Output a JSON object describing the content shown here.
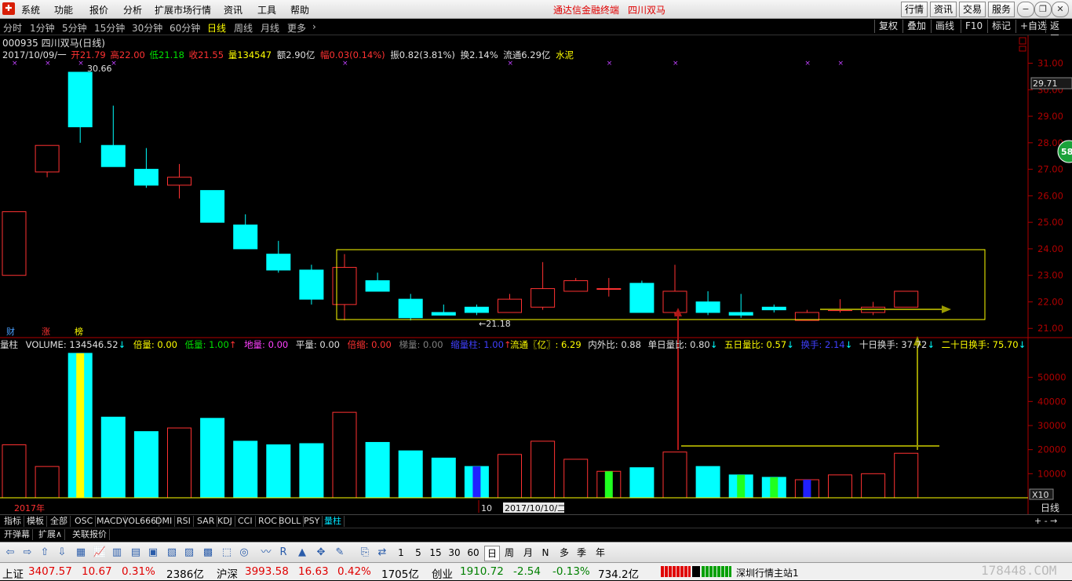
{
  "menu": [
    "系统",
    "功能",
    "报价",
    "分析",
    "扩展市场行情",
    "资讯",
    "工具",
    "帮助"
  ],
  "app_title": "通达信金融终端",
  "app_stock": "四川双马",
  "top_buttons": [
    "行情",
    "资讯",
    "交易",
    "服务"
  ],
  "periods": [
    "分时",
    "1分钟",
    "5分钟",
    "15分钟",
    "30分钟",
    "60分钟",
    "日线",
    "周线",
    "月线",
    "更多"
  ],
  "active_period": "日线",
  "right_buttons": [
    "复权",
    "叠加",
    "画线",
    "F10",
    "标记",
    "+自选",
    "返回"
  ],
  "stock_header": "000935 四川双马(日线)",
  "quote": {
    "date": "2017/10/09/一",
    "open_label": "开",
    "open": "21.79",
    "high_label": "高",
    "high": "22.00",
    "low_label": "低",
    "low": "21.18",
    "close_label": "收",
    "close": "21.55",
    "vol_label": "量",
    "vol": "134547",
    "amount": "额2.90亿",
    "change": "幅0.03(0.14%)",
    "amplitude": "振0.82(3.81%)",
    "turnover": "换2.14%",
    "float_cap": "流通6.29亿",
    "industry": "水泥"
  },
  "price_axis": [
    "31.00",
    "30.00",
    "29.00",
    "28.00",
    "27.00",
    "26.00",
    "25.00",
    "24.00",
    "23.00",
    "22.00",
    "21.00"
  ],
  "price_cursor": "29.71",
  "high_marker": "30.66",
  "low_marker": "←21.18",
  "circle_badge": "58",
  "markers": [
    "财",
    "涨",
    "榜"
  ],
  "vol_indicator": {
    "name": "量柱",
    "volume": "VOLUME: 134546.52",
    "beiliang": "倍量: 0.00",
    "diliang": "低量: 1.00",
    "diliang2": "地量: 0.00",
    "pingliang": "平量: 0.00",
    "beisuo": "倍缩: 0.00",
    "tiliang": "梯量: 0.00",
    "suoliang": "缩量柱: 1.00",
    "liutong": "流通〖亿〗: 6.29",
    "neiwai": "内外比: 0.88",
    "danri": "单日量比: 0.80",
    "wuri": "五日量比: 0.57",
    "huanshou": "换手: 2.14",
    "shiri": "十日换手: 37.72",
    "ershiri": "二十日换手: 75.70"
  },
  "vol_axis": [
    "50000",
    "40000",
    "30000",
    "20000",
    "10000"
  ],
  "vol_unit": "X10",
  "time_labels": {
    "year": "2017年",
    "month": "10",
    "cursor": "2017/10/10/二"
  },
  "chart_data": {
    "type": "candlestick",
    "ylim": [
      20.8,
      31.4
    ],
    "candles": [
      {
        "o": 23.0,
        "h": 25.4,
        "l": 23.0,
        "c": 25.4
      },
      {
        "o": 26.9,
        "h": 27.9,
        "l": 26.7,
        "c": 27.9
      },
      {
        "o": 30.66,
        "h": 30.66,
        "l": 28.0,
        "c": 28.6
      },
      {
        "o": 27.9,
        "h": 29.4,
        "l": 27.1,
        "c": 27.1
      },
      {
        "o": 27.0,
        "h": 27.8,
        "l": 26.3,
        "c": 26.4
      },
      {
        "o": 26.4,
        "h": 27.2,
        "l": 25.9,
        "c": 26.7
      },
      {
        "o": 26.2,
        "h": 26.2,
        "l": 25.0,
        "c": 25.0
      },
      {
        "o": 24.9,
        "h": 25.3,
        "l": 24.0,
        "c": 24.0
      },
      {
        "o": 23.8,
        "h": 24.3,
        "l": 23.1,
        "c": 23.2
      },
      {
        "o": 23.2,
        "h": 23.4,
        "l": 21.9,
        "c": 22.1
      },
      {
        "o": 21.9,
        "h": 23.8,
        "l": 21.3,
        "c": 23.3
      },
      {
        "o": 22.8,
        "h": 23.1,
        "l": 22.4,
        "c": 22.4
      },
      {
        "o": 22.1,
        "h": 22.3,
        "l": 21.3,
        "c": 21.4
      },
      {
        "o": 21.6,
        "h": 21.9,
        "l": 21.5,
        "c": 21.5
      },
      {
        "o": 21.8,
        "h": 21.9,
        "l": 21.5,
        "c": 21.6
      },
      {
        "o": 21.6,
        "h": 22.3,
        "l": 21.6,
        "c": 22.1
      },
      {
        "o": 21.8,
        "h": 23.5,
        "l": 21.7,
        "c": 22.5
      },
      {
        "o": 22.4,
        "h": 22.9,
        "l": 22.4,
        "c": 22.8
      },
      {
        "o": 22.5,
        "h": 22.9,
        "l": 22.2,
        "c": 22.5
      },
      {
        "o": 22.7,
        "h": 22.8,
        "l": 21.6,
        "c": 21.6
      },
      {
        "o": 21.6,
        "h": 23.4,
        "l": 21.5,
        "c": 22.4
      },
      {
        "o": 22.0,
        "h": 22.4,
        "l": 21.5,
        "c": 21.6
      },
      {
        "o": 21.6,
        "h": 22.3,
        "l": 21.4,
        "c": 21.5
      },
      {
        "o": 21.8,
        "h": 21.9,
        "l": 21.6,
        "c": 21.7
      },
      {
        "o": 21.3,
        "h": 21.7,
        "l": 21.3,
        "c": 21.6
      },
      {
        "o": 21.7,
        "h": 22.1,
        "l": 21.6,
        "c": 21.7
      },
      {
        "o": 21.6,
        "h": 22.0,
        "l": 21.5,
        "c": 21.8
      },
      {
        "o": 21.8,
        "h": 22.4,
        "l": 21.8,
        "c": 22.4
      }
    ],
    "volumes": [
      22000,
      13000,
      60000,
      33500,
      27500,
      29000,
      33000,
      23500,
      22000,
      22500,
      35500,
      23000,
      19500,
      16500,
      13000,
      18000,
      23500,
      16000,
      11000,
      12500,
      19000,
      13000,
      9500,
      8500,
      7500,
      9500,
      10000,
      18500
    ],
    "vol_ylim": [
      0,
      60000
    ],
    "markers_top": [
      0,
      1,
      2,
      3,
      10,
      15,
      18,
      20,
      24,
      25
    ]
  },
  "tabs": [
    "指标",
    "模板",
    "全部",
    "OSC",
    "MACD",
    "VOL666",
    "DMI",
    "RSI",
    "SAR",
    "KDJ",
    "CCI",
    "ROC",
    "BOLL",
    "PSY",
    "量柱"
  ],
  "active_tab": "量柱",
  "sub_tabs": [
    "开弹幕",
    "扩展∧",
    "关联报价"
  ],
  "right_period_label": "日线",
  "zoom_label": "+ - →",
  "toolbar_periods": [
    "1",
    "5",
    "15",
    "30",
    "60",
    "日",
    "周",
    "月",
    "N",
    "多",
    "季",
    "年"
  ],
  "status": {
    "sh_label": "上证",
    "sh_val": "3407.57",
    "sh_chg": "10.67",
    "sh_pct": "0.31%",
    "sh_amt": "2386亿",
    "sz_label": "沪深",
    "sz_val": "3993.58",
    "sz_chg": "16.63",
    "sz_pct": "0.42%",
    "sz_amt": "1705亿",
    "cy_label": "创业",
    "cy_val": "1910.72",
    "cy_chg": "-2.54",
    "cy_pct": "-0.13%",
    "cy_amt": "734.2亿",
    "server": "深圳行情主站1",
    "watermark": "178448.COM"
  },
  "colors": {
    "up": "#ff3232",
    "down": "#00ffff",
    "box": "#ffff00",
    "arrow_red": "#b01818",
    "arrow_olive": "#9a9a00"
  }
}
